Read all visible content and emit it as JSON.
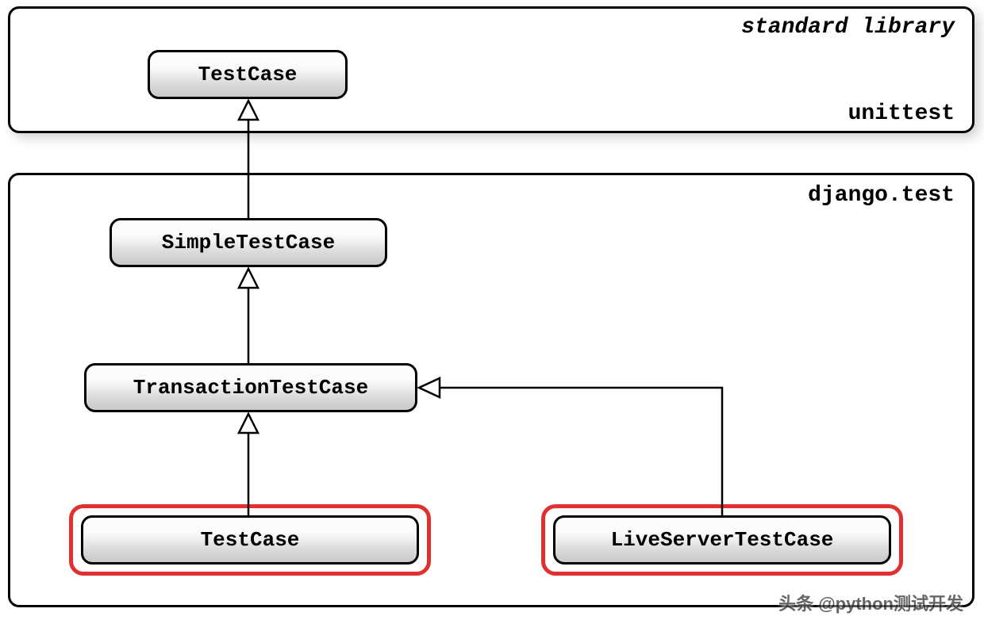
{
  "panels": {
    "top": {
      "title_italic": "standard library",
      "title_bottom": "unittest"
    },
    "bottom": {
      "title_topright": "django.test"
    }
  },
  "nodes": {
    "unittest_testcase": "TestCase",
    "simple_testcase": "SimpleTestCase",
    "transaction_testcase": "TransactionTestCase",
    "django_testcase": "TestCase",
    "liveserver_testcase": "LiveServerTestCase"
  },
  "edges": [
    {
      "from": "simple_testcase",
      "to": "unittest_testcase"
    },
    {
      "from": "transaction_testcase",
      "to": "simple_testcase"
    },
    {
      "from": "django_testcase",
      "to": "transaction_testcase"
    },
    {
      "from": "liveserver_testcase",
      "to": "transaction_testcase"
    }
  ],
  "highlighted": [
    "django_testcase",
    "liveserver_testcase"
  ],
  "watermark": "头条 @python测试开发"
}
